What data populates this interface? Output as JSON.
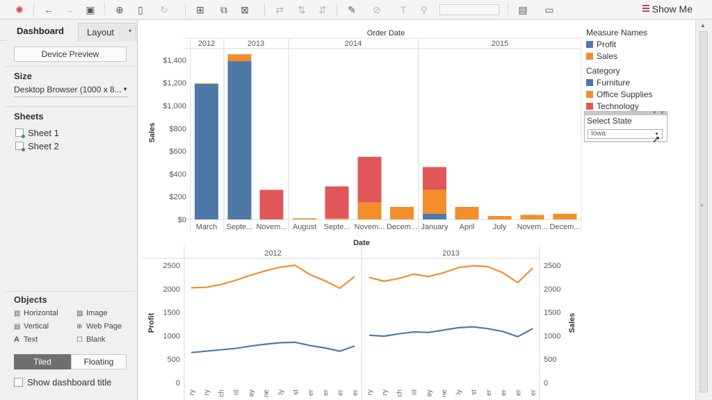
{
  "toolbar": {
    "show_me_label": "Show Me"
  },
  "left_panel": {
    "tabs": {
      "dashboard": "Dashboard",
      "layout": "Layout"
    },
    "device_preview_label": "Device Preview",
    "size": {
      "title": "Size",
      "value": "Desktop Browser (1000 x 8..."
    },
    "sheets": {
      "title": "Sheets",
      "items": [
        "Sheet 1",
        "Sheet 2"
      ]
    },
    "objects": {
      "title": "Objects",
      "items": [
        "Horizontal",
        "Image",
        "Vertical",
        "Web Page",
        "Text",
        "Blank"
      ]
    },
    "tiled_label": "Tiled",
    "floating_label": "Floating",
    "show_title_label": "Show dashboard title"
  },
  "legend": {
    "measure_title": "Measure Names",
    "measures": [
      {
        "name": "Profit",
        "color": "#4e79a7"
      },
      {
        "name": "Sales",
        "color": "#f28e2b"
      }
    ],
    "category_title": "Category",
    "categories": [
      {
        "name": "Furniture",
        "color": "#4e79a7"
      },
      {
        "name": "Office Supplies",
        "color": "#f28e2b"
      },
      {
        "name": "Technology",
        "color": "#e15759"
      }
    ]
  },
  "filter": {
    "title": "Select State",
    "value": "Iowa"
  },
  "chart_data": [
    {
      "type": "bar",
      "title": "Order Date",
      "xlabel": "Date",
      "ylabel": "Sales",
      "ylim": [
        0,
        1500
      ],
      "yticks": [
        "$0",
        "$200",
        "$400",
        "$600",
        "$800",
        "$1,000",
        "$1,200",
        "$1,400"
      ],
      "ytick_values": [
        0,
        200,
        400,
        600,
        800,
        1000,
        1200,
        1400
      ],
      "years": [
        {
          "label": "2012",
          "categories": [
            "March"
          ]
        },
        {
          "label": "2013",
          "categories": [
            "Septe...",
            "Novem..."
          ]
        },
        {
          "label": "2014",
          "categories": [
            "August",
            "Septe...",
            "Novem...",
            "Decem..."
          ]
        },
        {
          "label": "2015",
          "categories": [
            "January",
            "April",
            "July",
            "Novem...",
            "Decem..."
          ]
        }
      ],
      "stack_order": [
        "Furniture",
        "Office Supplies",
        "Technology"
      ],
      "series": [
        {
          "name": "Furniture",
          "values": [
            1190,
            1390,
            0,
            0,
            0,
            0,
            0,
            50,
            0,
            0,
            0,
            0
          ]
        },
        {
          "name": "Office Supplies",
          "values": [
            5,
            60,
            0,
            10,
            10,
            150,
            110,
            210,
            110,
            30,
            40,
            50
          ]
        },
        {
          "name": "Technology",
          "values": [
            0,
            0,
            260,
            0,
            280,
            400,
            0,
            200,
            0,
            0,
            0,
            0
          ]
        }
      ]
    },
    {
      "type": "line",
      "ylabel_left": "Profit",
      "ylabel_right": "Sales",
      "ylim": [
        0,
        2600
      ],
      "yticks": [
        "0",
        "500",
        "1000",
        "1500",
        "2000",
        "2500"
      ],
      "ytick_values": [
        0,
        500,
        1000,
        1500,
        2000,
        2500
      ],
      "panes": [
        "2012",
        "2013"
      ],
      "x_tick_labels": [
        "ry",
        "ry",
        "ch",
        "ril",
        "ay",
        "ne",
        "ly",
        "st",
        "er",
        "er",
        "er",
        "er"
      ],
      "series": [
        {
          "name": "Sales",
          "color": "#f28e2b",
          "values_2012": [
            2020,
            2030,
            2090,
            2180,
            2290,
            2380,
            2460,
            2500,
            2300,
            2170,
            2010,
            2260
          ],
          "values_2013": [
            2240,
            2160,
            2220,
            2310,
            2260,
            2340,
            2450,
            2490,
            2470,
            2340,
            2130,
            2440
          ]
        },
        {
          "name": "Profit",
          "color": "#4e79a7",
          "values_2012": [
            640,
            670,
            700,
            730,
            780,
            820,
            850,
            860,
            790,
            740,
            670,
            780
          ],
          "values_2013": [
            1010,
            990,
            1040,
            1080,
            1070,
            1120,
            1170,
            1190,
            1150,
            1090,
            980,
            1150
          ]
        }
      ]
    }
  ]
}
